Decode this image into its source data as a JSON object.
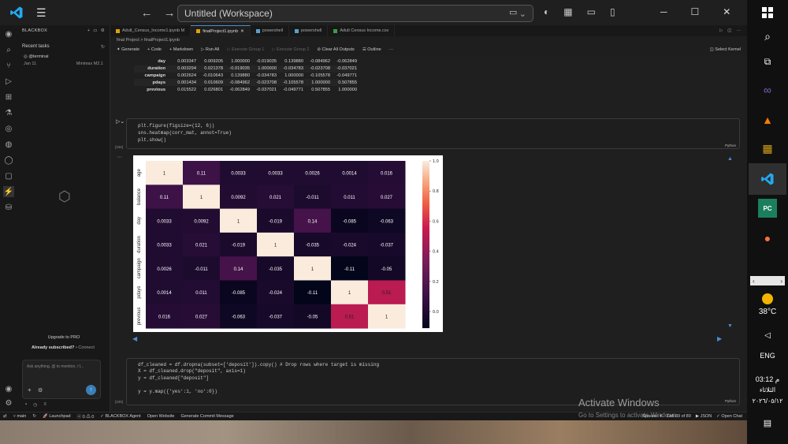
{
  "window": {
    "title": "Untitled (Workspace)"
  },
  "sidebar": {
    "header": "BLACKBOX",
    "recent_tasks": "Recent tasks",
    "terminal": {
      "name": "@terminal",
      "date": "Jan 11",
      "model": "Minimax M2.1"
    },
    "upgrade": "Upgrade to PRO",
    "already": "Already subscribed?",
    "connect": "• Connect",
    "chat_placeholder": "Ask anything, @ to mention, / t..."
  },
  "tabs": [
    {
      "label": "Adult_Census_Income1.ipynb M"
    },
    {
      "label": "finalProject1.ipynb"
    },
    {
      "label": "powershell"
    },
    {
      "label": "powershell"
    },
    {
      "label": "Adult Census Income.csv"
    }
  ],
  "breadcrumb": "final Project  >  finalProject1.ipynb",
  "toolbar": {
    "generate": "Generate",
    "code": "+ Code",
    "markdown": "+ Markdown",
    "run_all": "Run All",
    "exec1": "Execute Group 1",
    "exec2": "Execute Group 2",
    "clear": "Clear All Outputs",
    "outline": "Outline",
    "kernel": "Select Kernel"
  },
  "corr_table": {
    "rows": [
      {
        "label": "day",
        "vals": [
          "0.003347",
          "0.009205",
          "1.000000",
          "-0.019035",
          "0.139880",
          "-0.084962",
          "-0.062849"
        ]
      },
      {
        "label": "duration",
        "vals": [
          "0.003294",
          "0.021378",
          "-0.019035",
          "1.000000",
          "-0.034783",
          "-0.023708",
          "-0.037021"
        ]
      },
      {
        "label": "campaign",
        "vals": [
          "0.002624",
          "-0.010643",
          "0.139880",
          "-0.034783",
          "1.000000",
          "-0.105578",
          "-0.049771"
        ]
      },
      {
        "label": "pdays",
        "vals": [
          "0.001434",
          "0.010609",
          "-0.084962",
          "-0.023708",
          "-0.105578",
          "1.000000",
          "0.507855"
        ]
      },
      {
        "label": "previous",
        "vals": [
          "0.015522",
          "0.026801",
          "-0.062849",
          "-0.037021",
          "-0.049771",
          "0.507855",
          "1.000000"
        ]
      }
    ]
  },
  "cell1": {
    "lines": [
      "plt.figure(figsize=(12, 6))",
      "sns.heatmap(corr_mat, annot=True)",
      "plt.show()"
    ],
    "exec": "[338]",
    "lang": "Python"
  },
  "chart_data": {
    "type": "heatmap",
    "x": [
      "age",
      "balance",
      "day",
      "duration",
      "campaign",
      "pdays",
      "previous"
    ],
    "y": [
      "age",
      "balance",
      "day",
      "duration",
      "campaign",
      "pdays",
      "previous"
    ],
    "annotations": [
      [
        "1",
        "0.11",
        "0.0033",
        "0.0033",
        "0.0026",
        "0.0014",
        "0.016"
      ],
      [
        "0.11",
        "1",
        "0.0092",
        "0.021",
        "-0.011",
        "0.011",
        "0.027"
      ],
      [
        "0.0033",
        "0.0092",
        "1",
        "-0.019",
        "0.14",
        "-0.085",
        "-0.063"
      ],
      [
        "0.0033",
        "0.021",
        "-0.019",
        "1",
        "-0.035",
        "-0.024",
        "-0.037"
      ],
      [
        "0.0026",
        "-0.011",
        "0.14",
        "-0.035",
        "1",
        "-0.11",
        "-0.05"
      ],
      [
        "0.0014",
        "0.011",
        "-0.085",
        "-0.024",
        "-0.11",
        "1",
        "0.51"
      ],
      [
        "0.016",
        "0.027",
        "-0.063",
        "-0.037",
        "-0.05",
        "0.51",
        "1"
      ]
    ],
    "values": [
      [
        1,
        0.11,
        0.0033,
        0.0033,
        0.0026,
        0.0014,
        0.016
      ],
      [
        0.11,
        1,
        0.0092,
        0.021,
        -0.011,
        0.011,
        0.027
      ],
      [
        0.0033,
        0.0092,
        1,
        -0.019,
        0.14,
        -0.085,
        -0.063
      ],
      [
        0.0033,
        0.021,
        -0.019,
        1,
        -0.035,
        -0.024,
        -0.037
      ],
      [
        0.0026,
        -0.011,
        0.14,
        -0.035,
        1,
        -0.11,
        -0.05
      ],
      [
        0.0014,
        0.011,
        -0.085,
        -0.024,
        -0.11,
        1,
        0.51
      ],
      [
        0.016,
        0.027,
        -0.063,
        -0.037,
        -0.05,
        0.51,
        1
      ]
    ],
    "colorbar_ticks": [
      "1.0",
      "0.8",
      "0.6",
      "0.4",
      "0.2",
      "0.0"
    ],
    "colorbar_range": [
      -0.11,
      1.0
    ],
    "colormap": "rocket"
  },
  "cell2": {
    "lines": [
      "df_cleaned = df.dropna(subset=['deposit']).copy() # Drop rows where target is missing",
      "X = df_cleaned.drop(\"deposit\", axis=1)",
      "y = df_cleaned[\"deposit\"]",
      "",
      "y = y.map({'yes':1, 'no':0})"
    ],
    "exec": "[339]",
    "lang": "Python"
  },
  "statusbar": {
    "branch": "main",
    "sync": "↻",
    "launchpad": "Launchpad",
    "problems": "ⓧ 0 ⚠ 0",
    "blackbox": "BLACKBOX Agent",
    "open_website": "Open Website",
    "commit": "Generate Commit Message",
    "right": [
      "Spaces: 4",
      "Cell 89 of 89",
      "▶ JSON",
      "✓ Open Chat"
    ]
  },
  "watermark": {
    "line1": "Activate Windows",
    "line2": "Go to Settings to activate Windows."
  },
  "tray": {
    "temp": "38°C",
    "lang": "ENG",
    "time": "03:12 م",
    "day": "الثلاثاء",
    "date": "٢٠٢٦/٠٥/١٢"
  },
  "colors": {
    "accent": "#4e8ad0",
    "vscode_blue": "#23a9f2",
    "bg": "#1f1f1f"
  }
}
